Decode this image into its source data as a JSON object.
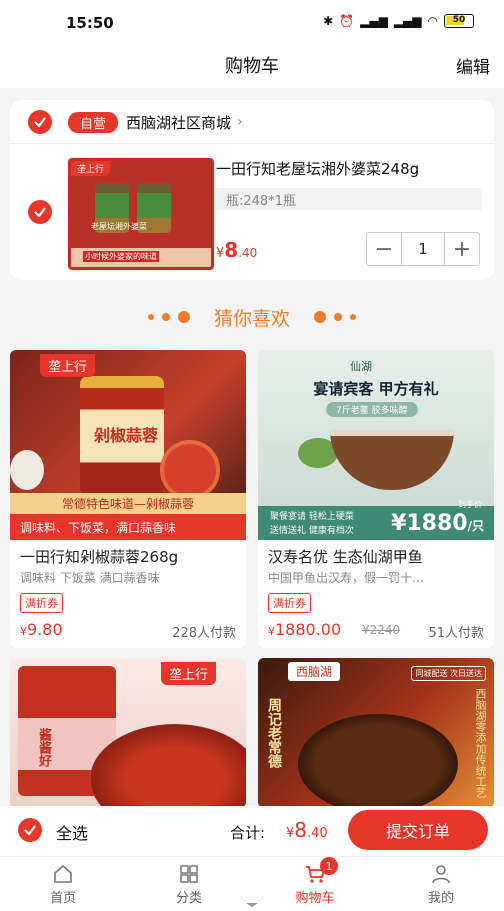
{
  "status_bar": {
    "time": "15:50",
    "battery": "50",
    "icons": [
      "bluetooth-icon",
      "alarm-icon",
      "hd-signal-icon",
      "hd-signal-icon",
      "wifi-icon",
      "battery-icon"
    ]
  },
  "header": {
    "title": "购物车",
    "edit": "编辑"
  },
  "store": {
    "badge": "自营",
    "name": "西脑湖社区商城",
    "checked": true
  },
  "cart_item": {
    "title": "一田行知老屋坛湘外婆菜248g",
    "spec": "瓶:248*1瓶",
    "price_currency": "¥",
    "price_int": "8",
    "price_dec": ".40",
    "quantity": "1",
    "thumb_tag": "垄上行",
    "thumb_caption1": "老屋坛湘外婆菜",
    "thumb_caption2": "小时候外婆家的味道",
    "checked": true
  },
  "guess": {
    "label": "猜你喜欢"
  },
  "products": [
    {
      "name": "一田行知剁椒蒜蓉268g",
      "subtitle": "调味料 下饭菜 满口蒜香味",
      "coupon": "满折券",
      "price_currency": "¥",
      "price": "9.80",
      "buyers": "228人付款",
      "image": {
        "tag": "垄上行",
        "jar_label": "剁椒蒜蓉",
        "band1": "常德特色味道—剁椒蒜蓉",
        "band2": "调味料、下饭菜，满口蒜香味"
      }
    },
    {
      "name": "汉寿名优 生态仙湖甲鱼",
      "subtitle": "中国甲鱼出汉寿，假一罚十…",
      "coupon": "满折券",
      "price_currency": "¥",
      "price": "1880.00",
      "old_price": "¥2240",
      "buyers": "51人付款",
      "image": {
        "brand": "仙湖",
        "headline": "宴请宾客 甲方有礼",
        "pill": "7斤老鳖 胶多味醇",
        "bottom1": "聚餐宴请 轻松上硬菜",
        "bottom2": "送情送礼 健康有档次",
        "hand_price_label": "到手价",
        "big_price": "¥1880",
        "big_unit": "/只"
      }
    },
    {
      "image": {
        "tag": "垄上行",
        "jar_text": "酱酱好"
      }
    },
    {
      "image": {
        "logo": "西脑湖",
        "vtext": "周记老常德",
        "vtext2": "西脑湖零添加传统工艺",
        "stamp": "同城配送 次日送达"
      }
    }
  ],
  "checkout": {
    "select_all": "全选",
    "total_label": "合计:",
    "total_currency": "¥",
    "total_int": "8",
    "total_dec": ".40",
    "submit": "提交订单"
  },
  "tabbar": {
    "items": [
      {
        "label": "首页",
        "icon": "home-icon"
      },
      {
        "label": "分类",
        "icon": "grid-icon"
      },
      {
        "label": "购物车",
        "icon": "cart-icon",
        "badge": "1",
        "active": true
      },
      {
        "label": "我的",
        "icon": "user-icon"
      }
    ]
  },
  "colors": {
    "accent": "#e8352c",
    "guess": "#f07c2a"
  }
}
